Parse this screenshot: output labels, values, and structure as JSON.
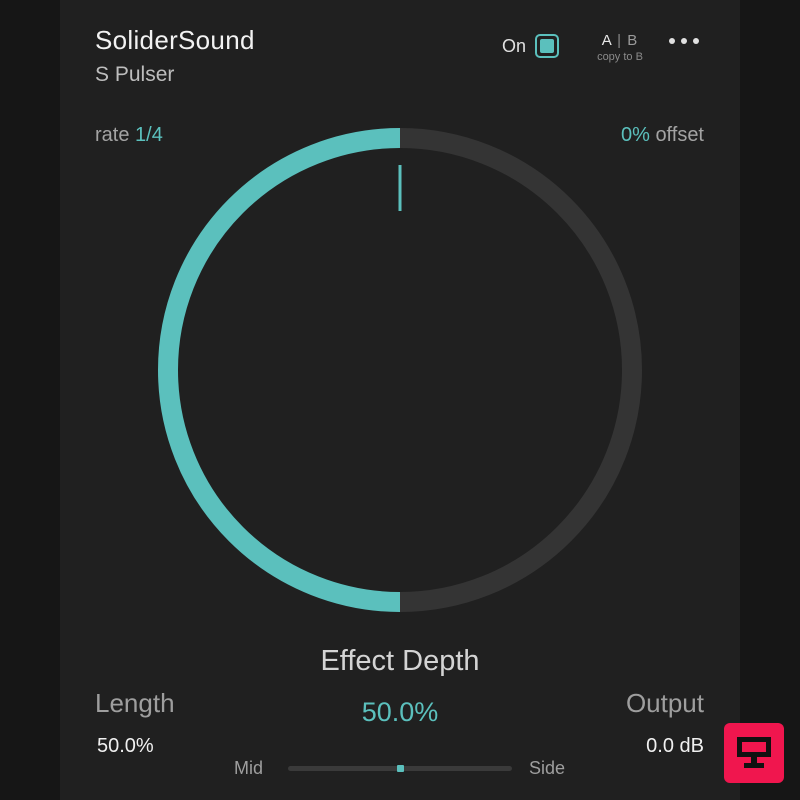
{
  "header": {
    "brand": "SoliderSound",
    "plugin": "S Pulser",
    "power": {
      "label": "On",
      "enabled": true
    },
    "ab": {
      "a": "A",
      "sep": "|",
      "b": "B",
      "copy": "copy to B"
    },
    "more_icon": "more-dots-icon"
  },
  "rate": {
    "label": "rate",
    "value": "1/4"
  },
  "offset": {
    "value": "0%",
    "label": "offset"
  },
  "dial": {
    "fill": 0.5,
    "accent": "#5bc0bd",
    "track": "#343434"
  },
  "effect_depth": {
    "label": "Effect Depth",
    "value": "50.0%"
  },
  "length": {
    "label": "Length",
    "value": "50.0%"
  },
  "output": {
    "label": "Output",
    "value": "0.0 dB"
  },
  "mid_side": {
    "left_label": "Mid",
    "right_label": "Side",
    "position": 0.5
  },
  "colors": {
    "accent": "#5bc0bd",
    "panel": "#202020",
    "background": "#161616"
  }
}
